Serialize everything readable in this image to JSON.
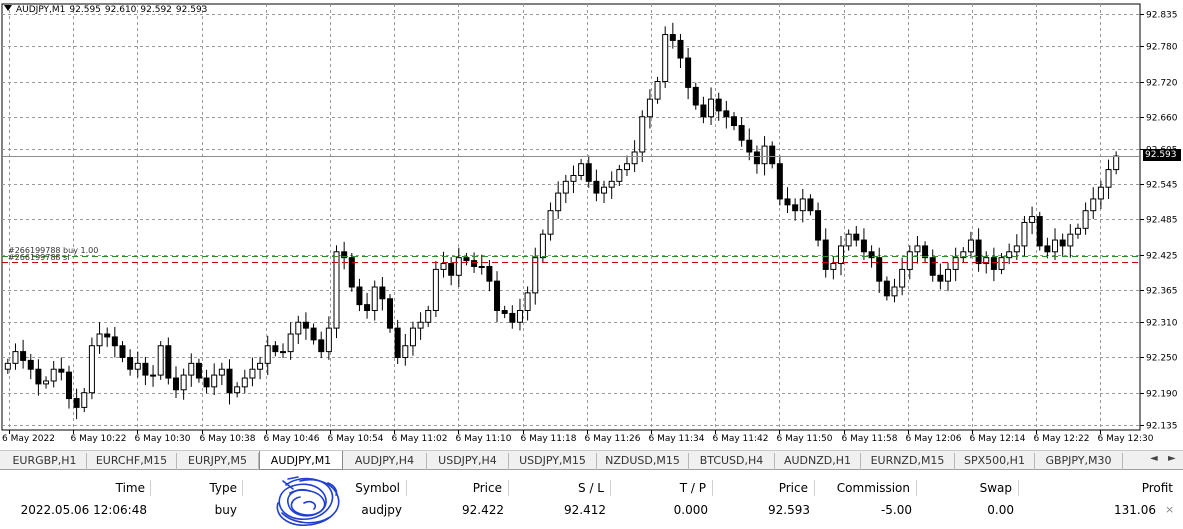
{
  "chart": {
    "symbol_tf": "AUDJPY,M1",
    "ohlc": [
      "92.595",
      "92.610",
      "92.592",
      "92.593"
    ],
    "current_price": "92.593",
    "position_labels": [
      "#266199788 buy 1.00",
      "#266199788 sl"
    ],
    "colors": {
      "grid": "#9a9a9a",
      "bull_fill": "#ffffff",
      "bear_fill": "#000000",
      "candle_edge": "#000000",
      "bid_line": "#8c8c8c",
      "entry_line": "#2e8b2e",
      "sl_line": "#cc0000",
      "green_candle": "#32cd32"
    },
    "price_levels": [
      "92.835",
      "92.780",
      "92.720",
      "92.660",
      "92.605",
      "92.545",
      "92.485",
      "92.425",
      "92.365",
      "92.310",
      "92.250",
      "92.190",
      "92.135"
    ],
    "time_labels": [
      "6 May 2022",
      "6 May 10:22",
      "6 May 10:30",
      "6 May 10:38",
      "6 May 10:46",
      "6 May 10:54",
      "6 May 11:02",
      "6 May 11:10",
      "6 May 11:18",
      "6 May 11:26",
      "6 May 11:34",
      "6 May 11:42",
      "6 May 11:50",
      "6 May 11:58",
      "6 May 12:06",
      "6 May 12:14",
      "6 May 12:22",
      "6 May 12:30"
    ],
    "entry_price": 92.422,
    "sl_price": 92.412,
    "candles_close": [
      92.24,
      92.26,
      92.245,
      92.23,
      92.205,
      92.21,
      92.23,
      92.225,
      92.18,
      92.165,
      92.19,
      92.27,
      92.29,
      92.285,
      92.27,
      92.25,
      92.23,
      92.24,
      92.22,
      92.22,
      92.27,
      92.215,
      92.195,
      92.22,
      92.24,
      92.215,
      92.2,
      92.22,
      92.23,
      92.19,
      92.2,
      92.215,
      92.23,
      92.24,
      92.27,
      92.26,
      92.26,
      92.29,
      92.31,
      92.3,
      92.28,
      92.26,
      92.3,
      92.43,
      92.42,
      92.37,
      92.34,
      92.33,
      92.37,
      92.35,
      92.3,
      92.25,
      92.27,
      92.3,
      92.31,
      92.33,
      92.4,
      92.41,
      92.39,
      92.42,
      92.415,
      92.405,
      92.405,
      92.38,
      92.33,
      92.325,
      92.31,
      92.33,
      92.36,
      92.42,
      92.46,
      92.5,
      92.53,
      92.55,
      92.56,
      92.58,
      92.55,
      92.53,
      92.54,
      92.55,
      92.57,
      92.58,
      92.6,
      92.66,
      92.69,
      92.72,
      92.8,
      92.79,
      92.76,
      92.71,
      92.68,
      92.66,
      92.69,
      92.67,
      92.66,
      92.645,
      92.62,
      92.6,
      92.58,
      92.61,
      92.58,
      92.52,
      92.51,
      92.5,
      92.52,
      92.5,
      92.45,
      92.4,
      92.41,
      92.44,
      92.46,
      92.45,
      92.43,
      92.42,
      92.38,
      92.355,
      92.37,
      92.4,
      92.43,
      92.44,
      92.42,
      92.39,
      92.38,
      92.4,
      92.42,
      92.43,
      92.45,
      92.41,
      92.42,
      92.4,
      92.42,
      92.43,
      92.44,
      92.48,
      92.49,
      92.44,
      92.43,
      92.45,
      92.44,
      92.46,
      92.47,
      92.5,
      92.52,
      92.54,
      92.57,
      92.593
    ]
  },
  "tabs": [
    "EURGBP,H1",
    "EURCHF,M15",
    "EURJPY,M5",
    "AUDJPY,M1",
    "AUDJPY,H4",
    "USDJPY,H4",
    "USDJPY,M15",
    "NZDUSD,M15",
    "BTCUSD,H4",
    "AUDNZD,H1",
    "EURNZD,M15",
    "SPX500,H1",
    "GBPJPY,M30"
  ],
  "active_tab": "AUDJPY,M1",
  "tab_arrows": {
    "left": "◄",
    "right": "►"
  },
  "trade_table": {
    "headers": {
      "time": "Time",
      "type": "Type",
      "symbol": "Symbol",
      "price_open": "Price",
      "sl": "S / L",
      "tp": "T / P",
      "price_current": "Price",
      "commission": "Commission",
      "swap": "Swap",
      "profit": "Profit"
    },
    "row": {
      "time": "2022.05.06 12:06:48",
      "type": "buy",
      "symbol": "audjpy",
      "price_open": "92.422",
      "sl": "92.412",
      "tp": "0.000",
      "price_current": "92.593",
      "commission": "-5.00",
      "swap": "0.00",
      "profit": "131.06",
      "close": "×"
    },
    "scribble_color": "#1f3fd1"
  }
}
